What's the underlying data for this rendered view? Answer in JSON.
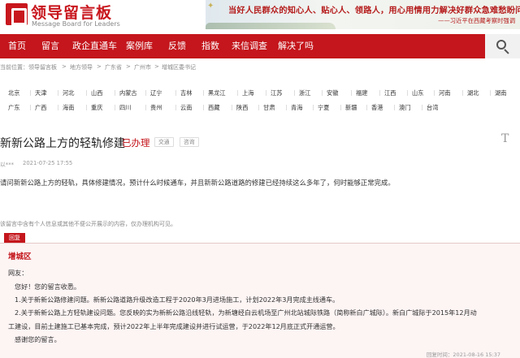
{
  "header": {
    "logo_cn": "领导留言板",
    "logo_en": "Message Board for Leaders",
    "banner_quote": "当好人民群众的知心人、贴心人、领路人，用心用情用力解决好群众急难愁盼问题。",
    "banner_source": "——习近平在西藏考察时强调"
  },
  "nav": {
    "items": [
      "首页",
      "留言",
      "政企直通车",
      "案例库",
      "反馈",
      "指数",
      "来信调查",
      "解决了吗"
    ],
    "search_icon": "search-icon"
  },
  "breadcrumb": {
    "prefix": "当前位置：",
    "items": [
      "领导留言板",
      "地方领导",
      "广东省",
      "广州市",
      "增城区委书记"
    ],
    "separator": ">"
  },
  "regions": {
    "row1": [
      "北京",
      "天津",
      "河北",
      "山西",
      "内蒙古",
      "辽宁",
      "吉林",
      "黑龙江",
      "上海",
      "江苏",
      "浙江",
      "安徽",
      "福建",
      "江西",
      "山东",
      "河南",
      "湖北",
      "湖南"
    ],
    "row2": [
      "广东",
      "广西",
      "海南",
      "重庆",
      "四川",
      "贵州",
      "云南",
      "西藏",
      "陕西",
      "甘肃",
      "青海",
      "宁夏",
      "新疆",
      "香港",
      "澳门",
      "台湾"
    ]
  },
  "message": {
    "title": "新新公路上方的轻轨修建",
    "status": "已办理",
    "tags": [
      "交通",
      "咨询"
    ],
    "font_toggle": "T",
    "author": "以***",
    "time": "2021-07-25 17:55",
    "content": "请问新新公路上方的轻轨，具体修建情况，预计什么时候通车，并且新新公路道路的修建已经持续这么多年了，何时能够正常完成。"
  },
  "notice": "该留言中含有个人信息或其他不便公开展示的内容，仅办理机构可见。",
  "reply": {
    "tab_label": "回复",
    "org": "增城区",
    "greeting": "网友：",
    "lines": [
      "您好！您的留言收悉。",
      "1.关于新新公路修建问题。新新公路道路升级改造工程于2020年3月进场施工，计划2022年3月完成主线通车。",
      "2.关于新新公路上方轻轨建设问题。您反映的实为新新公路沿线轻轨，为新塘经白云机场至广州北站城际铁路（简称新白广城际）。新白广城际于2015年12月动",
      "工建设，目前土建施工已基本完成，预计2022年上半年完成建设并进行试运营，于2022年12月底正式开通运营。",
      "感谢您的留言。"
    ],
    "time_label": "回复时间：",
    "time": "2021-08-16 15:37"
  }
}
